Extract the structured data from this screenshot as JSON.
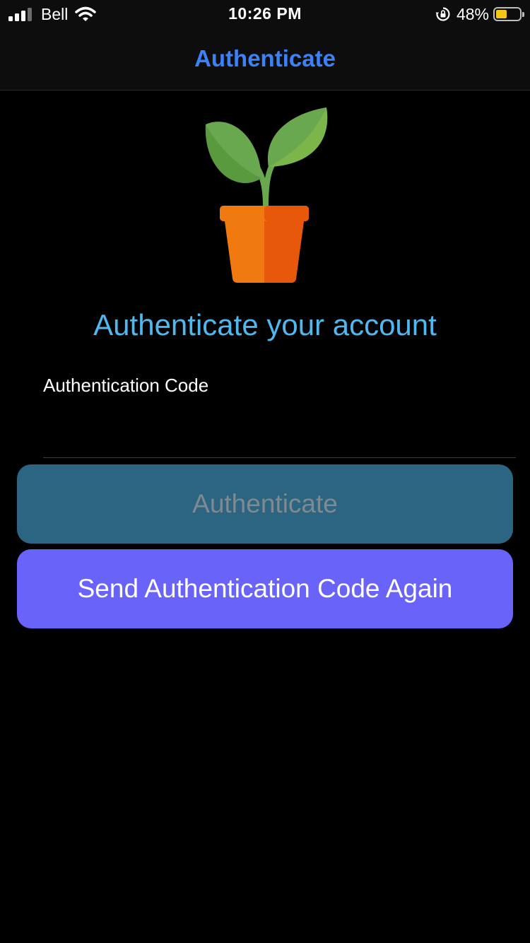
{
  "status_bar": {
    "carrier": "Bell",
    "time": "10:26 PM",
    "battery_percent": "48%",
    "battery_level": 0.48,
    "signal_bars_active": 3,
    "signal_bars_total": 4,
    "icons": [
      "signal-icon",
      "wifi-icon",
      "orientation-lock-icon",
      "battery-icon"
    ],
    "battery_color": "#f5c518"
  },
  "nav": {
    "title": "Authenticate",
    "title_color": "#3b82f6"
  },
  "hero": {
    "icon": "potted-plant-icon"
  },
  "heading": {
    "text": "Authenticate your account",
    "color": "#4fb8ee"
  },
  "form": {
    "code_label": "Authentication Code",
    "code_value": "",
    "code_placeholder": ""
  },
  "buttons": {
    "authenticate": {
      "label": "Authenticate",
      "state": "disabled",
      "background": "#2c6581"
    },
    "resend": {
      "label": "Send Authentication Code Again",
      "background": "#6a63fa"
    }
  }
}
